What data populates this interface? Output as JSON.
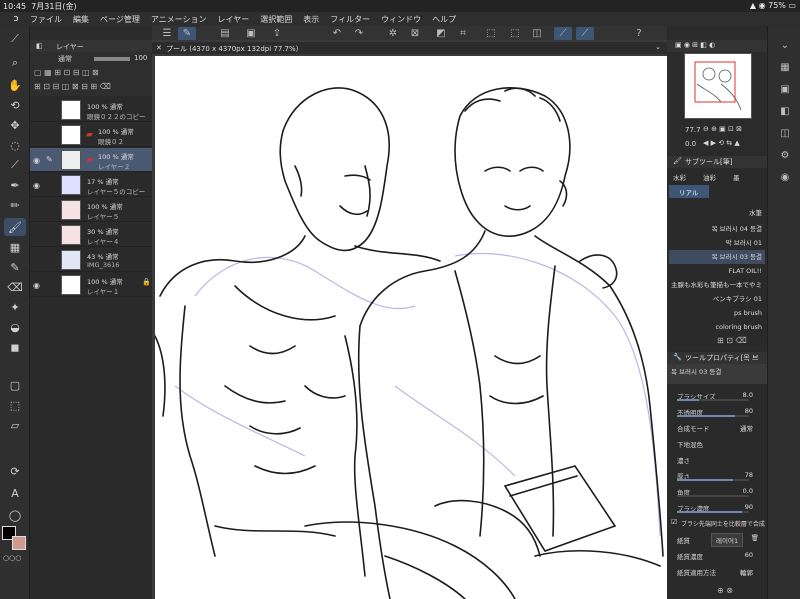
{
  "status": {
    "time": "10:45",
    "date": "7月31日(金)",
    "battery": "75%"
  },
  "menu": [
    "ファイル",
    "編集",
    "ページ管理",
    "アニメーション",
    "レイヤー",
    "選択範囲",
    "表示",
    "フィルター",
    "ウィンドウ",
    "ヘルプ"
  ],
  "document": {
    "tab_title": "プール (4370 x 4370px 132dpi 77.7%)"
  },
  "layer_panel": {
    "title": "レイヤー",
    "blend_mode": "通常",
    "opacity": "100",
    "layers": [
      {
        "line1": "100 % 通常",
        "line2": "眼鏡０２２のコピー"
      },
      {
        "line1": "100 % 通常",
        "line2": "眼鏡０２"
      },
      {
        "line1": "100 % 通常",
        "line2": "レイヤー２"
      },
      {
        "line1": "17 % 通常",
        "line2": "レイヤー５のコピー"
      },
      {
        "line1": "100 % 通常",
        "line2": "レイヤー５"
      },
      {
        "line1": "30 % 通常",
        "line2": "レイヤー４"
      },
      {
        "line1": "43 % 通常",
        "line2": "IMG_3616"
      },
      {
        "line1": "100 % 通常",
        "line2": "レイヤー１"
      }
    ]
  },
  "navigator": {
    "zoom": "77.7",
    "rotation": "0.0"
  },
  "sub_tool": {
    "title": "サブツール[筆]",
    "tabs": [
      "水彩",
      "油彩",
      "墨",
      "リアル"
    ],
    "brushes": [
      "水筆",
      "목 브러시 04 등결",
      "막 브러시 01",
      "목 브러시 03 등결",
      "FLAT OIL!!",
      "主腺も水彩も筆描も一本でやミ",
      "ペンキブラシ 01",
      "ps brush",
      "coloring brush"
    ]
  },
  "tool_property": {
    "title": "ツールプロパティ[목 브러]",
    "brush_name": "목 브러시 03 등결",
    "rows": [
      {
        "label": "ブラシサイズ",
        "value": "8.0",
        "level": 0.3
      },
      {
        "label": "不透明度",
        "value": "80",
        "level": 0.8
      },
      {
        "label": "合成モード",
        "value": "通常",
        "level": null
      },
      {
        "label": "下地混色",
        "value": "",
        "level": null
      },
      {
        "label": "濃さ",
        "value": "",
        "level": null
      },
      {
        "label": "厚さ",
        "value": "78",
        "level": 0.78
      },
      {
        "label": "角度",
        "value": "0.0",
        "level": 0.0
      },
      {
        "label": "ブラシ濃度",
        "value": "90",
        "level": 0.9
      }
    ],
    "checkbox_label": "ブラシ先端同士を比較層で合成",
    "paper_label": "紙質",
    "paper_value": "레이어1",
    "paper_density_label": "紙質濃度",
    "paper_density_value": "60",
    "paper_apply_label": "紙質適用方法",
    "paper_apply_value": "輪郭"
  }
}
